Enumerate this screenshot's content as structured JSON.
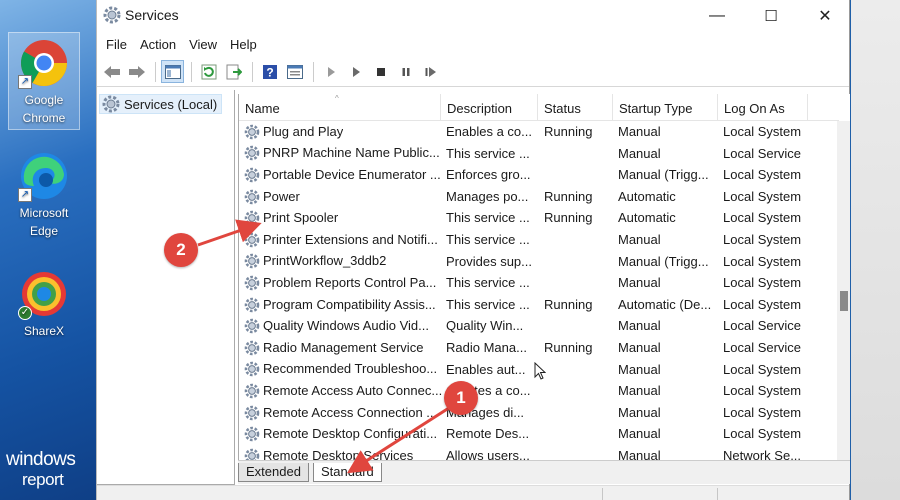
{
  "desktop": {
    "icons": [
      {
        "label_line1": "Google",
        "label_line2": "Chrome"
      },
      {
        "label_line1": "Microsoft",
        "label_line2": "Edge"
      },
      {
        "label_line1": "ShareX"
      }
    ],
    "watermark": {
      "line1": "windows",
      "line2": "report"
    }
  },
  "window": {
    "title": "Services",
    "controls": {
      "minimize": "—",
      "maximize": "☐",
      "close": "✕"
    }
  },
  "menu": [
    "File",
    "Action",
    "View",
    "Help"
  ],
  "tree": {
    "root_label": "Services (Local)"
  },
  "columns": {
    "name": "Name",
    "description": "Description",
    "status": "Status",
    "startup": "Startup Type",
    "logon": "Log On As"
  },
  "services": [
    {
      "name": "Plug and Play",
      "description": "Enables a co...",
      "status": "Running",
      "startup": "Manual",
      "logon": "Local System"
    },
    {
      "name": "PNRP Machine Name Public...",
      "description": "This service ...",
      "status": "",
      "startup": "Manual",
      "logon": "Local Service"
    },
    {
      "name": "Portable Device Enumerator ...",
      "description": "Enforces gro...",
      "status": "",
      "startup": "Manual (Trigg...",
      "logon": "Local System"
    },
    {
      "name": "Power",
      "description": "Manages po...",
      "status": "Running",
      "startup": "Automatic",
      "logon": "Local System"
    },
    {
      "name": "Print Spooler",
      "description": "This service ...",
      "status": "Running",
      "startup": "Automatic",
      "logon": "Local System"
    },
    {
      "name": "Printer Extensions and Notifi...",
      "description": "This service ...",
      "status": "",
      "startup": "Manual",
      "logon": "Local System"
    },
    {
      "name": "PrintWorkflow_3ddb2",
      "description": "Provides sup...",
      "status": "",
      "startup": "Manual (Trigg...",
      "logon": "Local System"
    },
    {
      "name": "Problem Reports Control Pa...",
      "description": "This service ...",
      "status": "",
      "startup": "Manual",
      "logon": "Local System"
    },
    {
      "name": "Program Compatibility Assis...",
      "description": "This service ...",
      "status": "Running",
      "startup": "Automatic (De...",
      "logon": "Local System"
    },
    {
      "name": "Quality Windows Audio Vid...",
      "description": "Quality Win...",
      "status": "",
      "startup": "Manual",
      "logon": "Local Service"
    },
    {
      "name": "Radio Management Service",
      "description": "Radio Mana...",
      "status": "Running",
      "startup": "Manual",
      "logon": "Local Service"
    },
    {
      "name": "Recommended Troubleshoo...",
      "description": "Enables aut...",
      "status": "",
      "startup": "Manual",
      "logon": "Local System"
    },
    {
      "name": "Remote Access Auto Connec...",
      "description": "Creates a co...",
      "status": "",
      "startup": "Manual",
      "logon": "Local System"
    },
    {
      "name": "Remote Access Connection ...",
      "description": "Manages di...",
      "status": "",
      "startup": "Manual",
      "logon": "Local System"
    },
    {
      "name": "Remote Desktop Configurati...",
      "description": "Remote Des...",
      "status": "",
      "startup": "Manual",
      "logon": "Local System"
    },
    {
      "name": "Remote Desktop Services",
      "description": "Allows users...",
      "status": "",
      "startup": "Manual",
      "logon": "Network Se..."
    }
  ],
  "tabs": {
    "extended": "Extended",
    "standard": "Standard"
  },
  "annotations": {
    "badge1": "1",
    "badge2": "2",
    "color": "#e0463e"
  }
}
